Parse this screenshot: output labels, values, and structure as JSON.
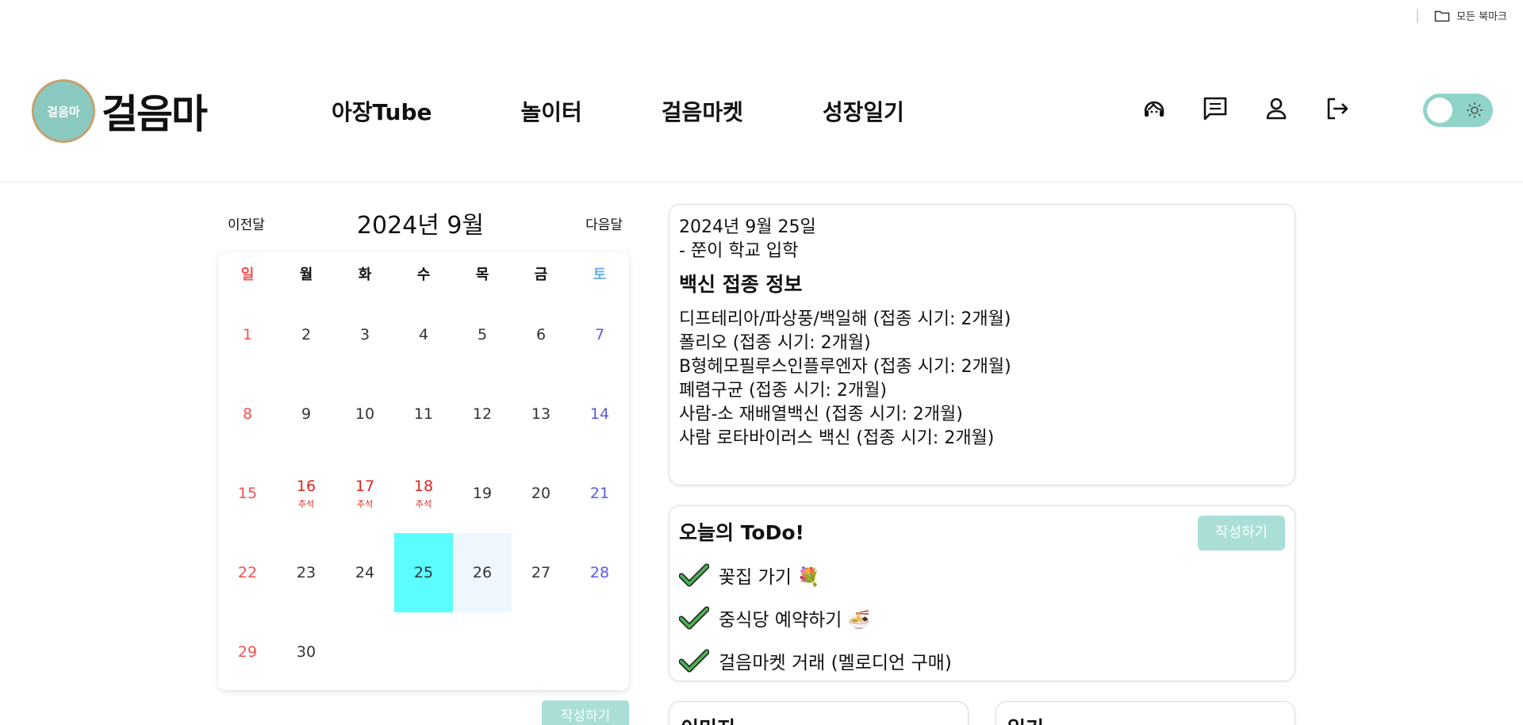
{
  "bookmarks": {
    "label": "모든 북마크"
  },
  "header": {
    "logo_badge": "걸음마",
    "logo_text": "걸음마",
    "nav": [
      "아장Tube",
      "놀이터",
      "걸음마켓",
      "성장일기"
    ]
  },
  "calendar": {
    "prev": "이전달",
    "next": "다음달",
    "title": "2024년 9월",
    "dow": [
      "일",
      "월",
      "화",
      "수",
      "목",
      "금",
      "토"
    ],
    "weeks": [
      [
        {
          "d": "1",
          "t": "sun"
        },
        {
          "d": "2"
        },
        {
          "d": "3"
        },
        {
          "d": "4"
        },
        {
          "d": "5"
        },
        {
          "d": "6"
        },
        {
          "d": "7",
          "t": "sat"
        }
      ],
      [
        {
          "d": "8",
          "t": "sun"
        },
        {
          "d": "9"
        },
        {
          "d": "10"
        },
        {
          "d": "11"
        },
        {
          "d": "12"
        },
        {
          "d": "13"
        },
        {
          "d": "14",
          "t": "sat"
        }
      ],
      [
        {
          "d": "15",
          "t": "sun"
        },
        {
          "d": "16",
          "t": "hol",
          "h": "추석"
        },
        {
          "d": "17",
          "t": "hol",
          "h": "추석"
        },
        {
          "d": "18",
          "t": "hol",
          "h": "추석"
        },
        {
          "d": "19"
        },
        {
          "d": "20"
        },
        {
          "d": "21",
          "t": "sat"
        }
      ],
      [
        {
          "d": "22",
          "t": "sun"
        },
        {
          "d": "23"
        },
        {
          "d": "24"
        },
        {
          "d": "25",
          "t": "today"
        },
        {
          "d": "26",
          "t": "sel"
        },
        {
          "d": "27"
        },
        {
          "d": "28",
          "t": "sat"
        }
      ],
      [
        {
          "d": "29",
          "t": "sun"
        },
        {
          "d": "30"
        }
      ]
    ],
    "write_button": "작성하기"
  },
  "info": {
    "date": "2024년 9월 25일",
    "note": "- 쭌이 학교 입학",
    "vaccine_title": "백신 접종 정보",
    "vaccines": [
      "디프테리아/파상풍/백일해 (접종 시기: 2개월)",
      "폴리오 (접종 시기: 2개월)",
      "B형헤모필루스인플루엔자 (접종 시기: 2개월)",
      "폐렴구균 (접종 시기: 2개월)",
      "사람-소 재배열백신 (접종 시기: 2개월)",
      "사람 로타바이러스 백신 (접종 시기: 2개월)"
    ]
  },
  "todo": {
    "title": "오늘의 ToDo!",
    "write_button": "작성하기",
    "items": [
      "꽃집 가기 💐",
      "중식당 예약하기 🍜",
      "걸음마켓 거래 (멜로디언 구매)"
    ]
  },
  "cards": {
    "image_title": "이미지",
    "diary_title": "일기"
  },
  "colors": {
    "accent": "#a9dfd7",
    "today": "#5cfdfd",
    "selected": "#eef6fe",
    "sunday": "#f0514e",
    "saturday": "#5a5ae8",
    "holiday": "#e0231b"
  },
  "icons": [
    "folder-icon",
    "headset-icon",
    "chat-icon",
    "user-icon",
    "logout-icon",
    "sun-icon",
    "check-icon"
  ]
}
